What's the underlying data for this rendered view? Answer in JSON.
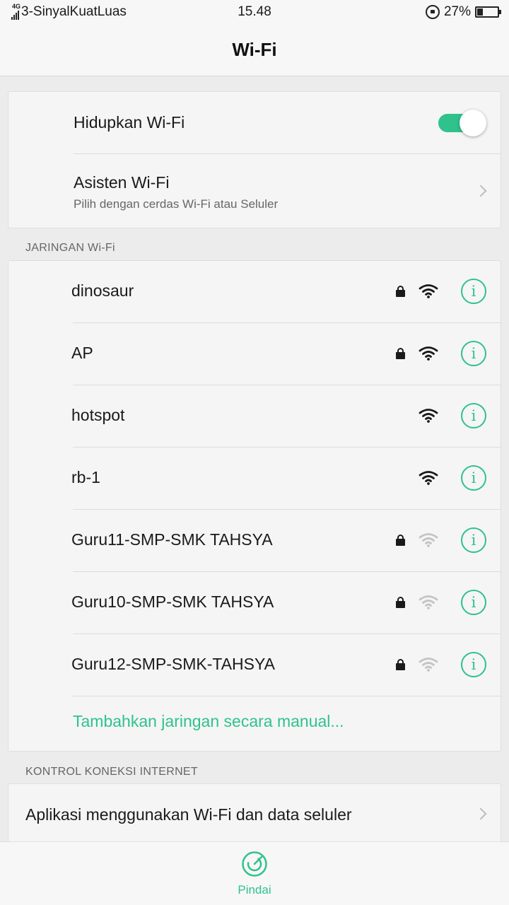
{
  "status_bar": {
    "network_type": "4G",
    "carrier": "3-SinyalKuatLuas",
    "time": "15.48",
    "battery_percent": "27%",
    "battery_level": 0.27
  },
  "header": {
    "title": "Wi-Fi"
  },
  "wifi_toggle": {
    "label": "Hidupkan Wi-Fi",
    "state": "on",
    "accent_color": "#2fc28c"
  },
  "wifi_assistant": {
    "label": "Asisten Wi-Fi",
    "sublabel": "Pilih dengan cerdas Wi-Fi atau Seluler"
  },
  "networks_section": {
    "title": "JARINGAN Wi-Fi",
    "networks": [
      {
        "name": "dinosaur",
        "secured": true,
        "signal": "strong"
      },
      {
        "name": "AP",
        "secured": true,
        "signal": "strong"
      },
      {
        "name": "hotspot",
        "secured": false,
        "signal": "strong"
      },
      {
        "name": "rb-1",
        "secured": false,
        "signal": "strong"
      },
      {
        "name": "Guru11-SMP-SMK TAHSYA",
        "secured": true,
        "signal": "weak"
      },
      {
        "name": "Guru10-SMP-SMK TAHSYA",
        "secured": true,
        "signal": "weak"
      },
      {
        "name": "Guru12-SMP-SMK-TAHSYA",
        "secured": true,
        "signal": "weak"
      }
    ],
    "info_icon_text": "i",
    "add_manual": "Tambahkan jaringan secara manual..."
  },
  "internet_control": {
    "title": "KONTROL KONEKSI INTERNET",
    "apps_item": "Aplikasi menggunakan Wi-Fi dan data seluler"
  },
  "bottom_bar": {
    "scan_label": "Pindai"
  }
}
